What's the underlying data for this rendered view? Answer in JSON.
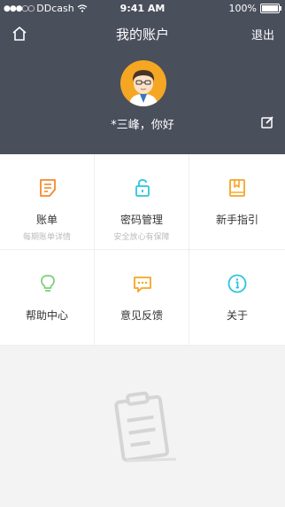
{
  "status_bar": {
    "carrier": "DDcash",
    "time": "9:41 AM",
    "battery": "100%",
    "battery_level": 1.0
  },
  "nav": {
    "title": "我的账户",
    "logout_label": "退出",
    "home_icon": "home-icon"
  },
  "profile": {
    "greeting": "*三峰，你好",
    "avatar_icon": "avatar-icon",
    "edit_icon": "edit-icon"
  },
  "menu": [
    {
      "label": "账单",
      "sub": "每期账单详情",
      "icon": "bill-icon",
      "color": "#f28a2e"
    },
    {
      "label": "密码管理",
      "sub": "安全放心有保障",
      "icon": "lock-icon",
      "color": "#2bc4e0"
    },
    {
      "label": "新手指引",
      "sub": "",
      "icon": "book-icon",
      "color": "#f5a623"
    },
    {
      "label": "帮助中心",
      "sub": "",
      "icon": "lightbulb-icon",
      "color": "#7ed07a"
    },
    {
      "label": "意见反馈",
      "sub": "",
      "icon": "chat-icon",
      "color": "#f5a623"
    },
    {
      "label": "关于",
      "sub": "",
      "icon": "info-icon",
      "color": "#2bc4e0"
    }
  ],
  "colors": {
    "header_bg": "#4a4f5c",
    "page_bg": "#f3f3f3",
    "avatar_bg": "#f5a623"
  }
}
